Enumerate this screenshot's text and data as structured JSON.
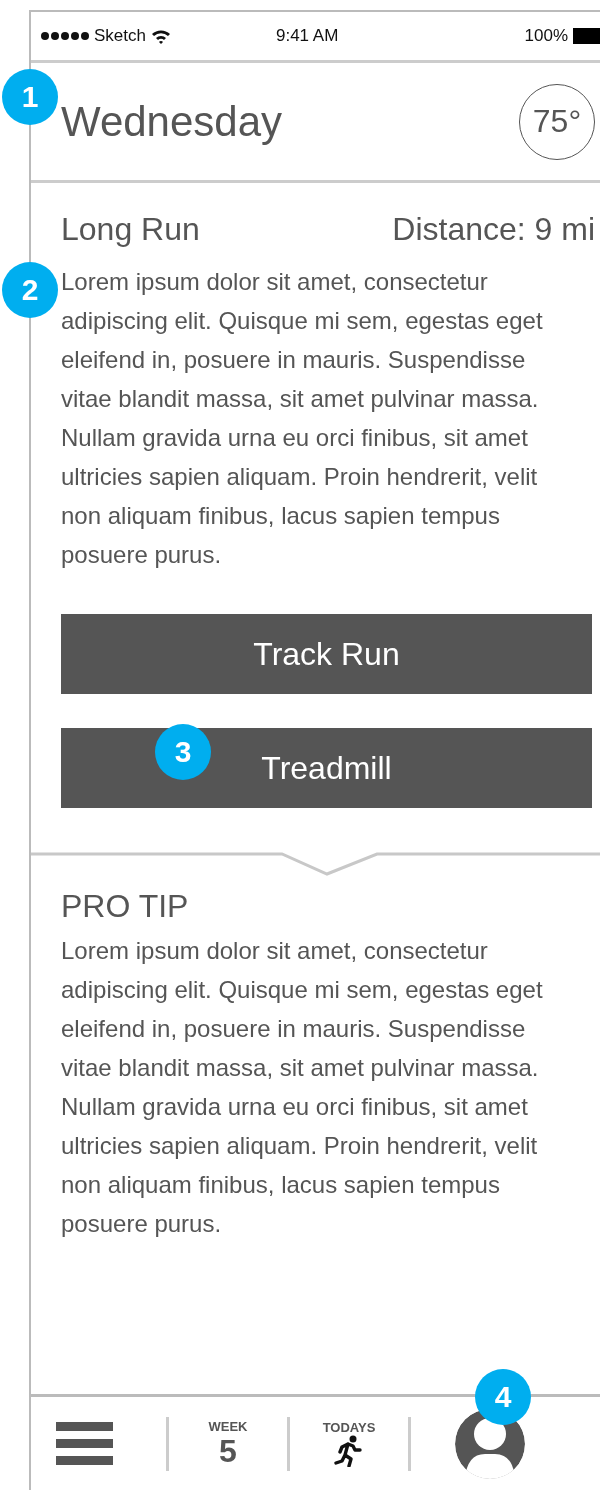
{
  "status_bar": {
    "carrier": "Sketch",
    "time": "9:41 AM",
    "battery": "100%"
  },
  "header": {
    "day": "Wednesday",
    "temperature": "75°"
  },
  "workout": {
    "title": "Long Run",
    "distance": "Distance: 9 mi",
    "description": "Lorem ipsum dolor sit amet, consectetur adipiscing elit. Quisque mi sem, egestas eget eleifend in, posuere in mauris. Suspendisse vitae blandit massa, sit amet pulvinar massa. Nullam gravida urna eu orci finibus, sit amet ultricies sapien aliquam. Proin hendrerit, velit non aliquam finibus, lacus sapien tempus posuere purus."
  },
  "buttons": [
    "Track Run",
    "Treadmill"
  ],
  "pro_tip": {
    "title": "PRO TIP",
    "text": "Lorem ipsum dolor sit amet, consectetur adipiscing elit. Quisque mi sem, egestas eget eleifend in, posuere in mauris. Suspendisse vitae blandit massa, sit amet pulvinar massa. Nullam gravida urna eu orci finibus, sit amet ultricies sapien aliquam. Proin hendrerit, velit non aliquam finibus, lacus sapien tempus posuere purus."
  },
  "tab_bar": {
    "week_label": "WEEK",
    "week_number": "5",
    "todays_label": "TODAYS"
  },
  "annotations": [
    "1",
    "2",
    "3",
    "4"
  ]
}
